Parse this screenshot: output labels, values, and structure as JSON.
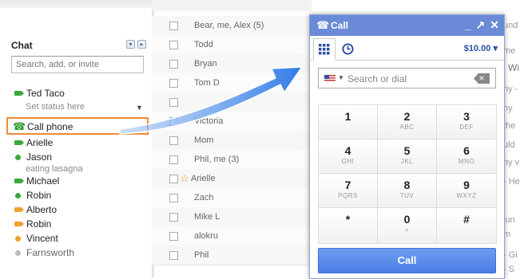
{
  "chat": {
    "header": "Chat",
    "search_placeholder": "Search, add, or invite",
    "self_name": "Ted Taco",
    "status_text": "Set status here",
    "status_caret": "▼",
    "call_phone_label": "Call phone",
    "contacts": [
      {
        "name": "Arielle",
        "status": "video",
        "sub": ""
      },
      {
        "name": "Jason",
        "status": "available",
        "sub": "eating lasagna"
      },
      {
        "name": "Michael",
        "status": "video",
        "sub": ""
      },
      {
        "name": "Robin",
        "status": "available",
        "sub": ""
      },
      {
        "name": "Alberto",
        "status": "idle-video",
        "sub": ""
      },
      {
        "name": "Robin",
        "status": "idle-video",
        "sub": ""
      },
      {
        "name": "Vincent",
        "status": "idle",
        "sub": ""
      },
      {
        "name": "Farnsworth",
        "status": "offline",
        "sub": ""
      }
    ]
  },
  "mail": {
    "rows": [
      {
        "sender": "Bear, me, Alex (5)",
        "starred": false
      },
      {
        "sender": "Todd",
        "starred": false
      },
      {
        "sender": "Bryan",
        "starred": false
      },
      {
        "sender": "Tom D",
        "starred": false
      },
      {
        "sender": "",
        "starred": false
      },
      {
        "sender": "Victoria",
        "starred": false
      },
      {
        "sender": "Mom",
        "starred": false
      },
      {
        "sender": "Phil, me (3)",
        "starred": false
      },
      {
        "sender": "Arielle",
        "starred": true
      },
      {
        "sender": "Zach",
        "starred": false
      },
      {
        "sender": "Mike L",
        "starred": false
      },
      {
        "sender": "alokru",
        "starred": false
      },
      {
        "sender": "Phil",
        "starred": false
      }
    ],
    "preview_fragments": [
      "und",
      "me",
      "l Wi",
      "ny -",
      "ny",
      "the",
      "uld",
      "hy v",
      "- He",
      "",
      "lun",
      "m",
      "- Gi",
      "- S"
    ]
  },
  "call_window": {
    "title": "Call",
    "credit": "$10.00",
    "credit_caret": "▾",
    "dial_placeholder": "Search or dial",
    "keys": [
      {
        "digit": "1",
        "letters": ""
      },
      {
        "digit": "2",
        "letters": "ABC"
      },
      {
        "digit": "3",
        "letters": "DEF"
      },
      {
        "digit": "4",
        "letters": "GHI"
      },
      {
        "digit": "5",
        "letters": "JKL"
      },
      {
        "digit": "6",
        "letters": "MNO"
      },
      {
        "digit": "7",
        "letters": "PQRS"
      },
      {
        "digit": "8",
        "letters": "TUV"
      },
      {
        "digit": "9",
        "letters": "WXYZ"
      },
      {
        "digit": "*",
        "letters": ""
      },
      {
        "digit": "0",
        "letters": "+"
      },
      {
        "digit": "#",
        "letters": ""
      }
    ],
    "call_button": "Call"
  },
  "colors": {
    "accent_blue": "#4a7fe6",
    "title_blue": "#6a8ad8",
    "highlight_orange": "#f28a3a",
    "available_green": "#3aa83a",
    "idle_orange": "#f0a030",
    "offline_grey": "#bbbbbb"
  },
  "icons": {
    "call_phone": "phone-icon",
    "dialpad_tab": "dialpad-icon",
    "history_tab": "clock-icon",
    "backspace": "backspace-icon",
    "window_minimize": "minimize-icon",
    "window_popout": "popout-icon",
    "window_close": "close-icon"
  }
}
